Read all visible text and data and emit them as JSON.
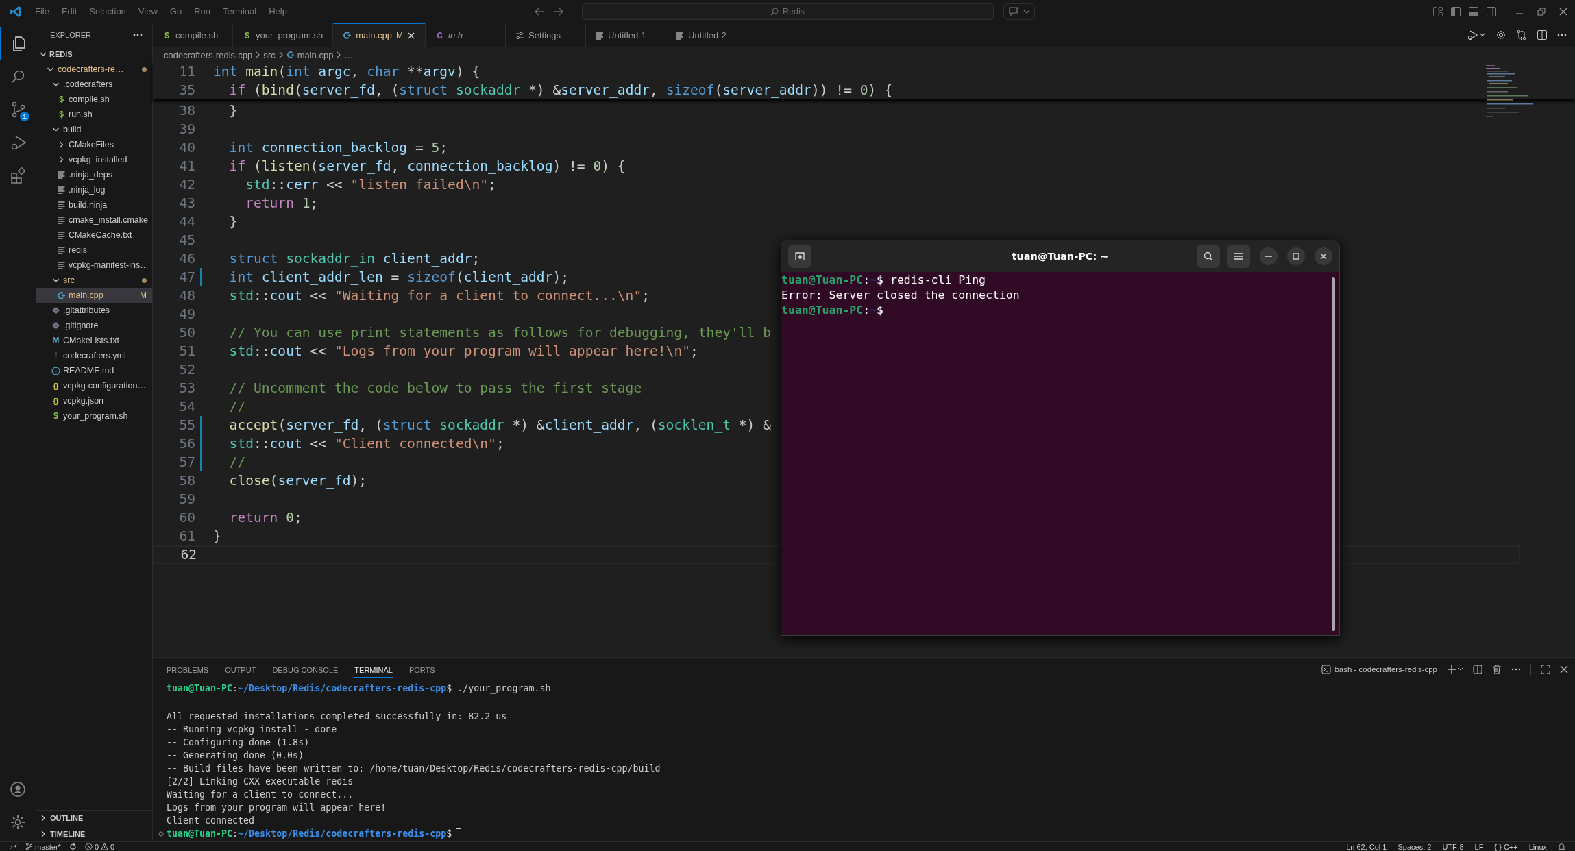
{
  "title_bar": {
    "menu": [
      "File",
      "Edit",
      "Selection",
      "View",
      "Go",
      "Run",
      "Terminal",
      "Help"
    ],
    "search": {
      "value": "Redis"
    }
  },
  "activity_bar": {
    "items": [
      {
        "kind": "explorer",
        "selected": true
      },
      {
        "kind": "search",
        "selected": false
      },
      {
        "kind": "source-control",
        "selected": false,
        "badge": "1"
      },
      {
        "kind": "run-debug",
        "selected": false
      },
      {
        "kind": "extensions",
        "selected": false
      }
    ]
  },
  "sidebar": {
    "title": "EXPLORER",
    "section": {
      "label": "REDIS",
      "expanded": true
    },
    "tree": [
      {
        "label": "codecrafters-re…",
        "kind": "folder",
        "expanded": true,
        "modified": true,
        "children": [
          {
            "label": ".codecrafters",
            "kind": "folder",
            "expanded": true,
            "modified": false,
            "children": [
              {
                "label": "compile.sh",
                "kind": "shell",
                "icon": "$",
                "modified": false
              },
              {
                "label": "run.sh",
                "kind": "shell",
                "icon": "$",
                "modified": false
              }
            ]
          },
          {
            "label": "build",
            "kind": "folder",
            "expanded": true,
            "modified": false,
            "children": [
              {
                "label": "CMakeFiles",
                "kind": "folder",
                "expanded": false,
                "modified": false
              },
              {
                "label": "vcpkg_installed",
                "kind": "folder",
                "expanded": false,
                "modified": false
              },
              {
                "label": ".ninja_deps",
                "kind": "text",
                "modified": false
              },
              {
                "label": ".ninja_log",
                "kind": "text",
                "modified": false
              },
              {
                "label": "build.ninja",
                "kind": "text",
                "modified": false
              },
              {
                "label": "cmake_install.cmake",
                "kind": "text",
                "modified": false
              },
              {
                "label": "CMakeCache.txt",
                "kind": "text",
                "modified": false
              },
              {
                "label": "redis",
                "kind": "text",
                "modified": false
              },
              {
                "label": "vcpkg-manifest-ins…",
                "kind": "text",
                "modified": false
              }
            ]
          },
          {
            "label": "src",
            "kind": "folder",
            "expanded": true,
            "modified": true,
            "children": [
              {
                "label": "main.cpp",
                "kind": "cpp",
                "modified": true,
                "badge": "M",
                "selected": true
              }
            ]
          },
          {
            "label": ".gitattributes",
            "kind": "git",
            "modified": false
          },
          {
            "label": ".gitignore",
            "kind": "git",
            "modified": false
          },
          {
            "label": "CMakeLists.txt",
            "kind": "cmake",
            "icon": "M",
            "modified": false
          },
          {
            "label": "codecrafters.yml",
            "kind": "yaml",
            "icon": "!",
            "modified": false
          },
          {
            "label": "README.md",
            "kind": "info",
            "modified": false
          },
          {
            "label": "vcpkg-configuration…",
            "kind": "json",
            "icon": "{}",
            "modified": false
          },
          {
            "label": "vcpkg.json",
            "kind": "json",
            "icon": "{}",
            "modified": false
          },
          {
            "label": "your_program.sh",
            "kind": "shell",
            "icon": "$",
            "modified": false
          }
        ]
      }
    ],
    "bottom_sections": [
      {
        "label": "OUTLINE",
        "expanded": false
      },
      {
        "label": "TIMELINE",
        "expanded": false
      }
    ]
  },
  "tabs": [
    {
      "label": "compile.sh",
      "kind": "shell",
      "icon": "$",
      "selected": false,
      "preview": false
    },
    {
      "label": "your_program.sh",
      "kind": "shell",
      "icon": "$",
      "selected": false,
      "preview": false
    },
    {
      "label": "main.cpp",
      "kind": "cpp",
      "badge": "M",
      "selected": true,
      "preview": false
    },
    {
      "label": "in.h",
      "kind": "header",
      "icon": "C",
      "selected": false,
      "preview": true
    },
    {
      "label": "Settings",
      "kind": "settings",
      "selected": false,
      "preview": false
    },
    {
      "label": "Untitled-1",
      "kind": "text",
      "selected": false,
      "preview": false
    },
    {
      "label": "Untitled-2",
      "kind": "text",
      "selected": false,
      "preview": false
    }
  ],
  "breadcrumb": [
    {
      "label": "codecrafters-redis-cpp",
      "kind": "folder"
    },
    {
      "label": "src",
      "kind": "folder"
    },
    {
      "label": "main.cpp",
      "kind": "cpp"
    },
    {
      "label": "…",
      "kind": "symbol"
    }
  ],
  "editor": {
    "sticky": [
      {
        "number": "11",
        "tokens": [
          {
            "kind": "keyword",
            "text": "int"
          },
          {
            "kind": "function",
            "text": " main"
          },
          {
            "kind": "plain",
            "text": "("
          },
          {
            "kind": "keyword",
            "text": "int"
          },
          {
            "kind": "variable",
            "text": " argc"
          },
          {
            "kind": "plain",
            "text": ", "
          },
          {
            "kind": "keyword",
            "text": "char"
          },
          {
            "kind": "plain",
            "text": " **"
          },
          {
            "kind": "variable",
            "text": "argv"
          },
          {
            "kind": "plain",
            "text": ") {"
          }
        ]
      },
      {
        "number": "35",
        "tokens": [
          {
            "kind": "control",
            "text": "  if"
          },
          {
            "kind": "plain",
            "text": " ("
          },
          {
            "kind": "function",
            "text": "bind"
          },
          {
            "kind": "plain",
            "text": "("
          },
          {
            "kind": "variable",
            "text": "server_fd"
          },
          {
            "kind": "plain",
            "text": ", ("
          },
          {
            "kind": "keyword",
            "text": "struct"
          },
          {
            "kind": "type",
            "text": " sockaddr"
          },
          {
            "kind": "plain",
            "text": " *) &"
          },
          {
            "kind": "variable",
            "text": "server_addr"
          },
          {
            "kind": "plain",
            "text": ", "
          },
          {
            "kind": "keyword",
            "text": "sizeof"
          },
          {
            "kind": "plain",
            "text": "("
          },
          {
            "kind": "variable",
            "text": "server_addr"
          },
          {
            "kind": "plain",
            "text": ")) != "
          },
          {
            "kind": "number",
            "text": "0"
          },
          {
            "kind": "plain",
            "text": ") {"
          }
        ]
      }
    ],
    "lines": [
      {
        "number": "38",
        "modified": false,
        "current": false,
        "tokens": [
          {
            "kind": "plain",
            "text": "  }"
          }
        ]
      },
      {
        "number": "39",
        "modified": false,
        "current": false
      },
      {
        "number": "40",
        "modified": false,
        "current": false,
        "tokens": [
          {
            "kind": "keyword",
            "text": "  int"
          },
          {
            "kind": "variable",
            "text": " connection_backlog"
          },
          {
            "kind": "plain",
            "text": " = "
          },
          {
            "kind": "number",
            "text": "5"
          },
          {
            "kind": "plain",
            "text": ";"
          }
        ]
      },
      {
        "number": "41",
        "modified": false,
        "current": false,
        "tokens": [
          {
            "kind": "control",
            "text": "  if"
          },
          {
            "kind": "plain",
            "text": " ("
          },
          {
            "kind": "function",
            "text": "listen"
          },
          {
            "kind": "plain",
            "text": "("
          },
          {
            "kind": "variable",
            "text": "server_fd"
          },
          {
            "kind": "plain",
            "text": ", "
          },
          {
            "kind": "variable",
            "text": "connection_backlog"
          },
          {
            "kind": "plain",
            "text": ") != "
          },
          {
            "kind": "number",
            "text": "0"
          },
          {
            "kind": "plain",
            "text": ") {"
          }
        ]
      },
      {
        "number": "42",
        "modified": false,
        "current": false,
        "tokens": [
          {
            "kind": "type",
            "text": "    std"
          },
          {
            "kind": "plain",
            "text": "::"
          },
          {
            "kind": "variable",
            "text": "cerr"
          },
          {
            "kind": "plain",
            "text": " << "
          },
          {
            "kind": "string",
            "text": "\"listen failed\\n\""
          },
          {
            "kind": "plain",
            "text": ";"
          }
        ]
      },
      {
        "number": "43",
        "modified": false,
        "current": false,
        "tokens": [
          {
            "kind": "control",
            "text": "    return"
          },
          {
            "kind": "number",
            "text": " 1"
          },
          {
            "kind": "plain",
            "text": ";"
          }
        ]
      },
      {
        "number": "44",
        "modified": false,
        "current": false,
        "tokens": [
          {
            "kind": "plain",
            "text": "  }"
          }
        ]
      },
      {
        "number": "45",
        "modified": false,
        "current": false
      },
      {
        "number": "46",
        "modified": false,
        "current": false,
        "tokens": [
          {
            "kind": "keyword",
            "text": "  struct"
          },
          {
            "kind": "type",
            "text": " sockaddr_in"
          },
          {
            "kind": "variable",
            "text": " client_addr"
          },
          {
            "kind": "plain",
            "text": ";"
          }
        ]
      },
      {
        "number": "47",
        "modified": true,
        "current": false,
        "tokens": [
          {
            "kind": "keyword",
            "text": "  int"
          },
          {
            "kind": "variable",
            "text": " client_addr_len"
          },
          {
            "kind": "plain",
            "text": " = "
          },
          {
            "kind": "keyword",
            "text": "sizeof"
          },
          {
            "kind": "plain",
            "text": "("
          },
          {
            "kind": "variable",
            "text": "client_addr"
          },
          {
            "kind": "plain",
            "text": ");"
          }
        ]
      },
      {
        "number": "48",
        "modified": false,
        "current": false,
        "tokens": [
          {
            "kind": "type",
            "text": "  std"
          },
          {
            "kind": "plain",
            "text": "::"
          },
          {
            "kind": "variable",
            "text": "cout"
          },
          {
            "kind": "plain",
            "text": " << "
          },
          {
            "kind": "string",
            "text": "\"Waiting for a client to connect...\\n\""
          },
          {
            "kind": "plain",
            "text": ";"
          }
        ]
      },
      {
        "number": "49",
        "modified": false,
        "current": false
      },
      {
        "number": "50",
        "modified": false,
        "current": false,
        "tokens": [
          {
            "kind": "comment",
            "text": "  // You can use print statements as follows for debugging, they'll b"
          }
        ]
      },
      {
        "number": "51",
        "modified": false,
        "current": false,
        "tokens": [
          {
            "kind": "type",
            "text": "  std"
          },
          {
            "kind": "plain",
            "text": "::"
          },
          {
            "kind": "variable",
            "text": "cout"
          },
          {
            "kind": "plain",
            "text": " << "
          },
          {
            "kind": "string",
            "text": "\"Logs from your program will appear here!\\n\""
          },
          {
            "kind": "plain",
            "text": ";"
          }
        ]
      },
      {
        "number": "52",
        "modified": false,
        "current": false
      },
      {
        "number": "53",
        "modified": false,
        "current": false,
        "tokens": [
          {
            "kind": "comment",
            "text": "  // Uncomment the code below to pass the first stage"
          }
        ]
      },
      {
        "number": "54",
        "modified": false,
        "current": false,
        "tokens": [
          {
            "kind": "comment",
            "text": "  //"
          }
        ]
      },
      {
        "number": "55",
        "modified": true,
        "current": false,
        "tokens": [
          {
            "kind": "function",
            "text": "  accept"
          },
          {
            "kind": "plain",
            "text": "("
          },
          {
            "kind": "variable",
            "text": "server_fd"
          },
          {
            "kind": "plain",
            "text": ", ("
          },
          {
            "kind": "keyword",
            "text": "struct"
          },
          {
            "kind": "type",
            "text": " sockaddr"
          },
          {
            "kind": "plain",
            "text": " *) &"
          },
          {
            "kind": "variable",
            "text": "client_addr"
          },
          {
            "kind": "plain",
            "text": ", ("
          },
          {
            "kind": "type",
            "text": "socklen_t"
          },
          {
            "kind": "plain",
            "text": " *) &"
          }
        ]
      },
      {
        "number": "56",
        "modified": true,
        "current": false,
        "tokens": [
          {
            "kind": "type",
            "text": "  std"
          },
          {
            "kind": "plain",
            "text": "::"
          },
          {
            "kind": "variable",
            "text": "cout"
          },
          {
            "kind": "plain",
            "text": " << "
          },
          {
            "kind": "string",
            "text": "\"Client connected\\n\""
          },
          {
            "kind": "plain",
            "text": ";"
          }
        ]
      },
      {
        "number": "57",
        "modified": true,
        "current": false,
        "tokens": [
          {
            "kind": "comment",
            "text": "  //"
          }
        ]
      },
      {
        "number": "58",
        "modified": false,
        "current": false,
        "tokens": [
          {
            "kind": "function",
            "text": "  close"
          },
          {
            "kind": "plain",
            "text": "("
          },
          {
            "kind": "variable",
            "text": "server_fd"
          },
          {
            "kind": "plain",
            "text": ");"
          }
        ]
      },
      {
        "number": "59",
        "modified": false,
        "current": false
      },
      {
        "number": "60",
        "modified": false,
        "current": false,
        "tokens": [
          {
            "kind": "control",
            "text": "  return"
          },
          {
            "kind": "number",
            "text": " 0"
          },
          {
            "kind": "plain",
            "text": ";"
          }
        ]
      },
      {
        "number": "61",
        "modified": false,
        "current": false,
        "tokens": [
          {
            "kind": "plain",
            "text": "}"
          }
        ]
      },
      {
        "number": "62",
        "modified": false,
        "current": true
      }
    ]
  },
  "panel": {
    "tabs": [
      {
        "label": "PROBLEMS",
        "selected": false
      },
      {
        "label": "OUTPUT",
        "selected": false
      },
      {
        "label": "DEBUG CONSOLE",
        "selected": false
      },
      {
        "label": "TERMINAL",
        "selected": true
      },
      {
        "label": "PORTS",
        "selected": false
      }
    ],
    "terminal_name": "bash - codecrafters-redis-cpp",
    "sticky": {
      "kind": "prompt",
      "user": "tuan@Tuan-PC",
      "separator": ":",
      "path": "~/Desktop/Redis/codecrafters-redis-cpp",
      "rest": "$ ./your_program.sh"
    },
    "lines": [
      {
        "kind": "output",
        "text": "All requested installations completed successfully in: 82.2 us"
      },
      {
        "kind": "output",
        "text": "-- Running vcpkg install - done"
      },
      {
        "kind": "output",
        "text": "-- Configuring done (1.8s)"
      },
      {
        "kind": "output",
        "text": "-- Generating done (0.0s)"
      },
      {
        "kind": "output",
        "text": "-- Build files have been written to: /home/tuan/Desktop/Redis/codecrafters-redis-cpp/build"
      },
      {
        "kind": "output",
        "text": "[2/2] Linking CXX executable redis"
      },
      {
        "kind": "output",
        "text": "Waiting for a client to connect..."
      },
      {
        "kind": "output",
        "text": "Logs from your program will appear here!"
      },
      {
        "kind": "output",
        "text": "Client connected"
      },
      {
        "kind": "prompt",
        "user": "tuan@Tuan-PC",
        "separator": ":",
        "path": "~/Desktop/Redis/codecrafters-redis-cpp",
        "rest": "$",
        "cursor": true,
        "marker": true
      }
    ]
  },
  "status_bar": {
    "branch": "master*",
    "errors": "0",
    "warnings": "0",
    "position": "Ln 62, Col 1",
    "indent": "Spaces: 2",
    "encoding": "UTF-8",
    "eol": "LF",
    "language_icon": "{ }",
    "language": "C++",
    "os": "Linux"
  },
  "terminal_window": {
    "title": "tuan@Tuan-PC: ~",
    "lines": [
      {
        "kind": "prompt",
        "user": "tuan@Tuan-PC",
        "separator": ":",
        "path": "~",
        "rest": "$ redis-cli Ping"
      },
      {
        "kind": "output",
        "text": "Error: Server closed the connection"
      },
      {
        "kind": "prompt",
        "user": "tuan@Tuan-PC",
        "separator": ":",
        "path": "~",
        "rest": "$"
      }
    ]
  }
}
